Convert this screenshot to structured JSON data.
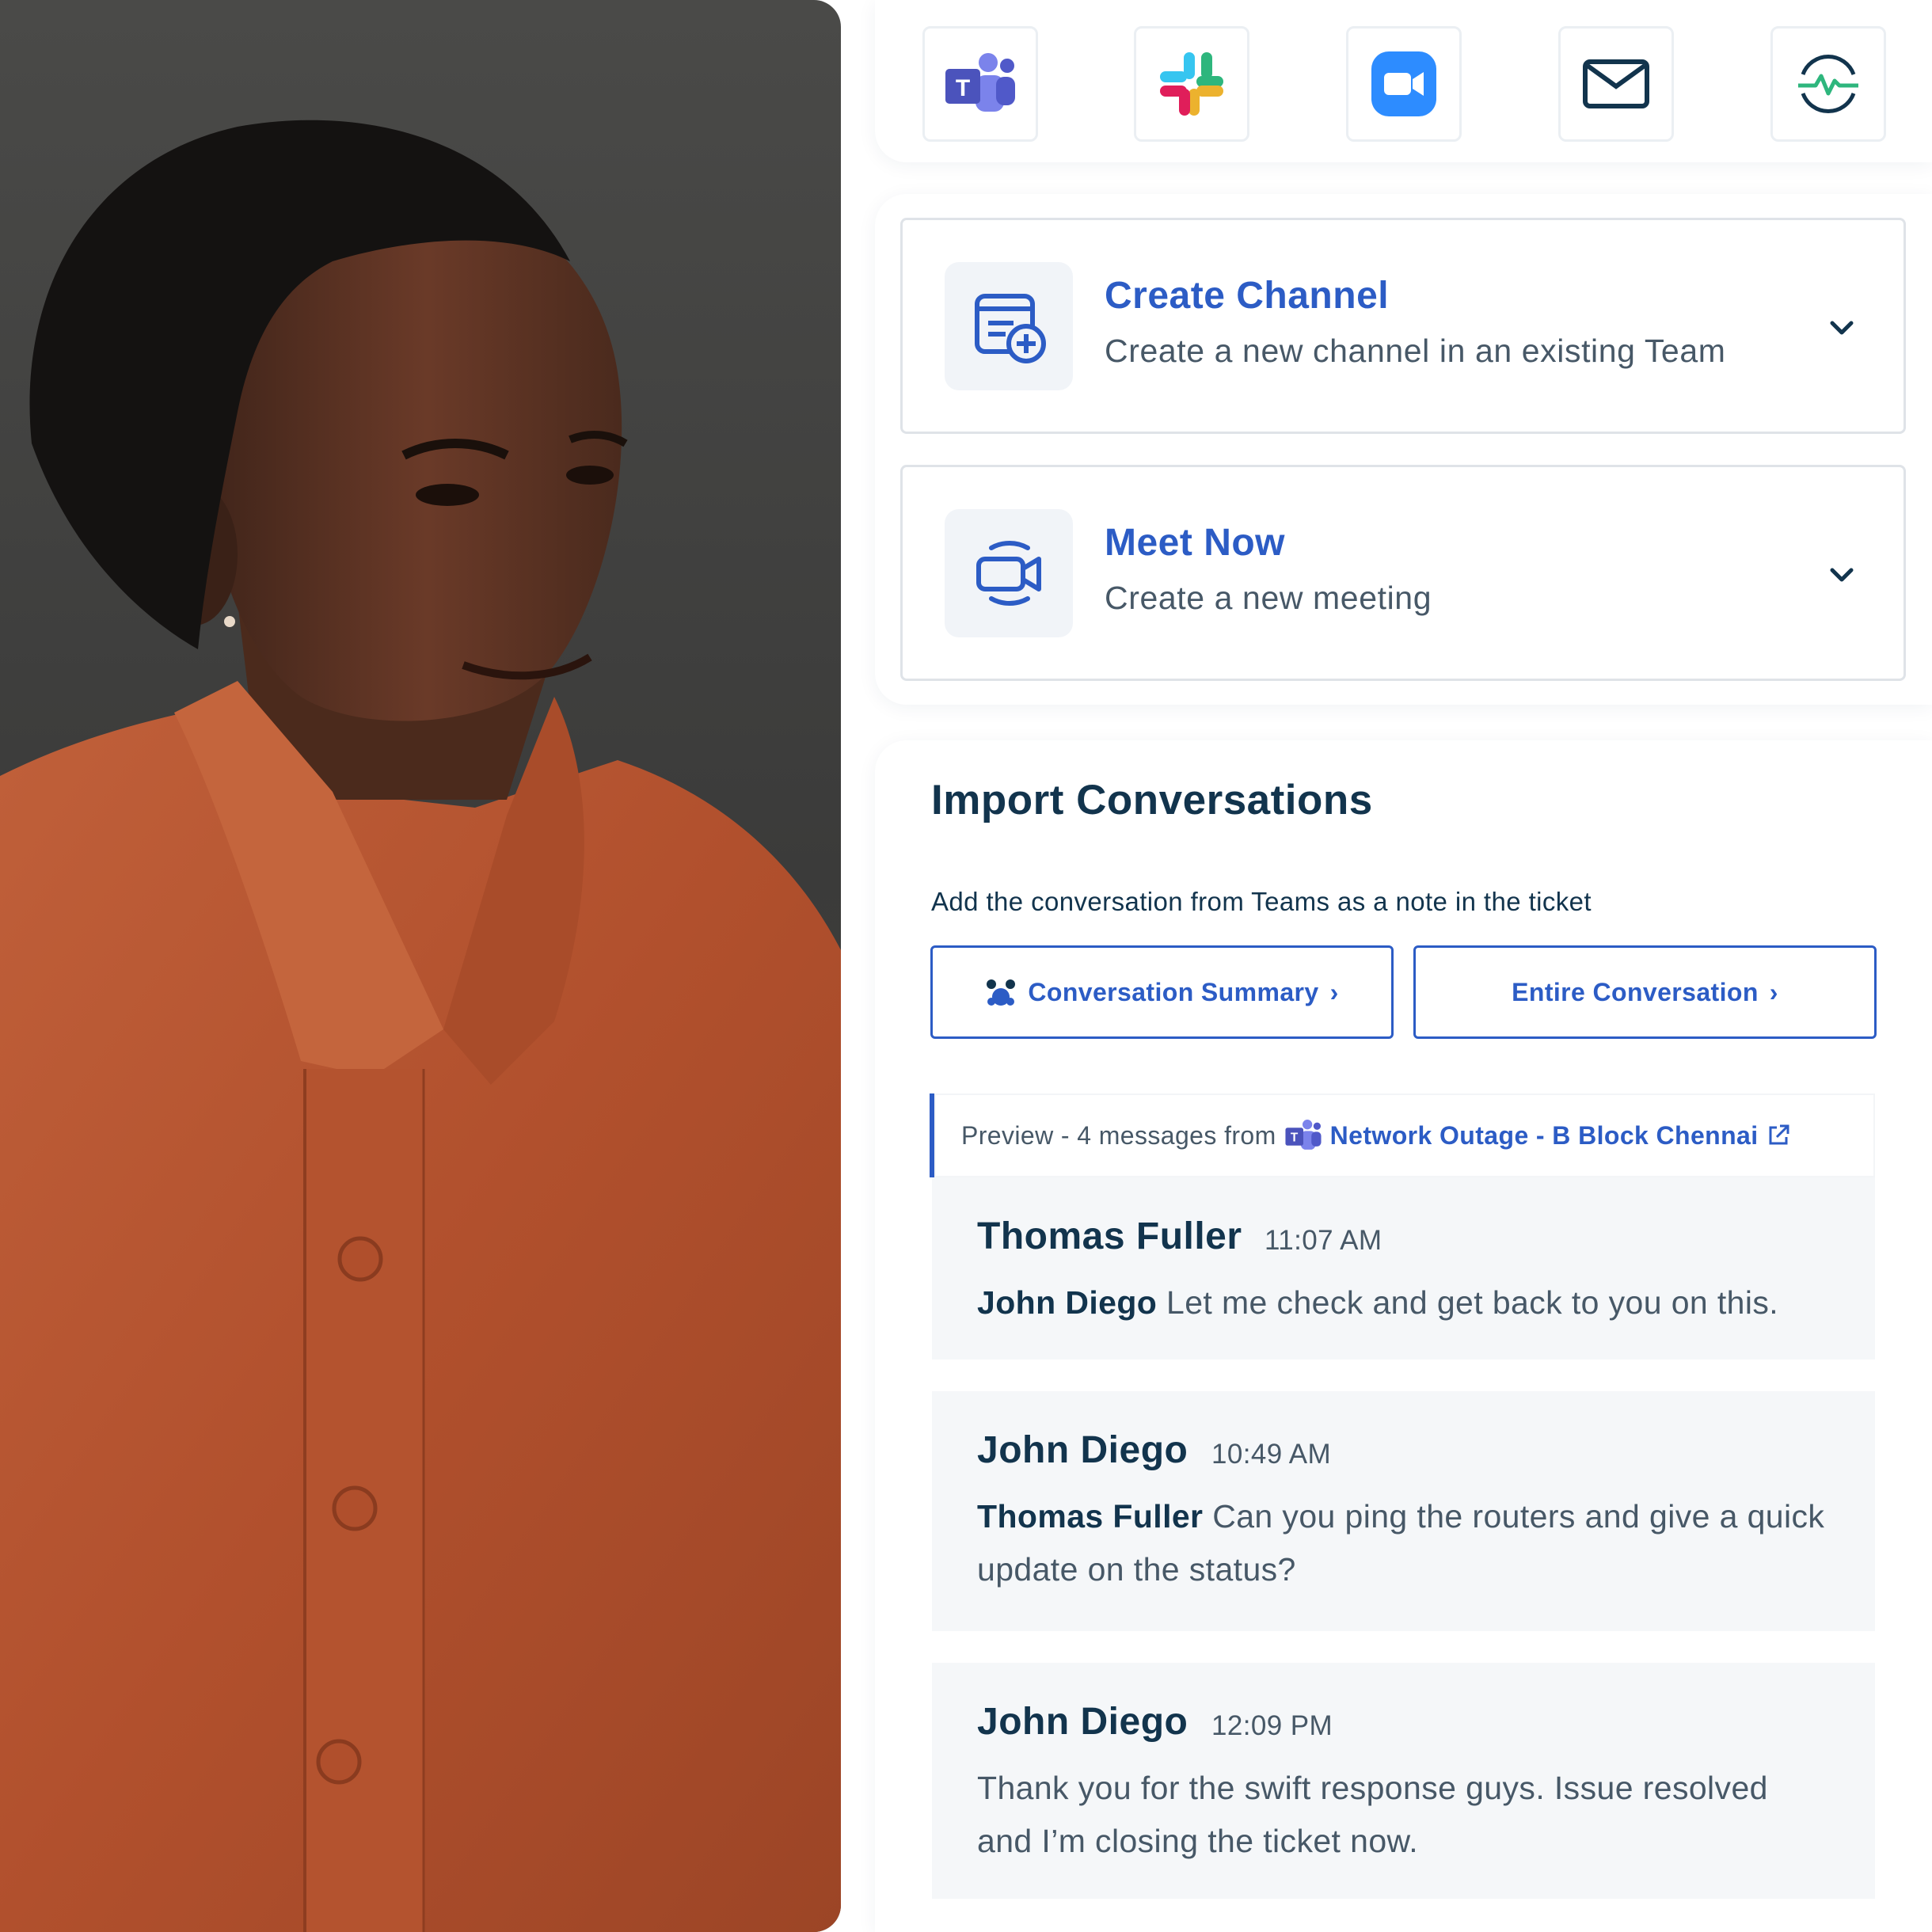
{
  "integrations": [
    {
      "name": "Microsoft Teams",
      "icon": "teams-icon"
    },
    {
      "name": "Slack",
      "icon": "slack-icon"
    },
    {
      "name": "Zoom",
      "icon": "zoom-icon"
    },
    {
      "name": "Email",
      "icon": "mail-icon"
    },
    {
      "name": "Monitoring",
      "icon": "pulse-monitor-icon"
    }
  ],
  "actions": [
    {
      "title": "Create Channel",
      "subtitle": "Create a new channel in an existing Team",
      "icon": "create-channel-icon"
    },
    {
      "title": "Meet Now",
      "subtitle": "Create a new meeting",
      "icon": "video-meeting-icon"
    }
  ],
  "import": {
    "title": "Import Conversations",
    "description": "Add the conversation from Teams as a note in the ticket",
    "summary_button": "Conversation Summary",
    "entire_button": "Entire Conversation",
    "preview_prefix": "Preview - 4 messages from",
    "preview_source": "Network Outage - B Block Chennai"
  },
  "messages": [
    {
      "author": "Thomas Fuller",
      "time": "11:07 AM",
      "mention": "John Diego",
      "text": " Let me check and get back to you on this."
    },
    {
      "author": "John Diego",
      "time": "10:49 AM",
      "mention": "Thomas Fuller",
      "text": " Can you ping the routers and give a quick update on the status?"
    },
    {
      "author": "John Diego",
      "time": "12:09 PM",
      "mention": "",
      "text": "Thank you for the swift response guys. Issue resolved and I’m closing the ticket now."
    }
  ],
  "colors": {
    "primary": "#2c5cc5",
    "text_dark": "#12344d",
    "text_muted": "#475867",
    "shirt": "#b8552f",
    "background_photo": "#404040"
  }
}
